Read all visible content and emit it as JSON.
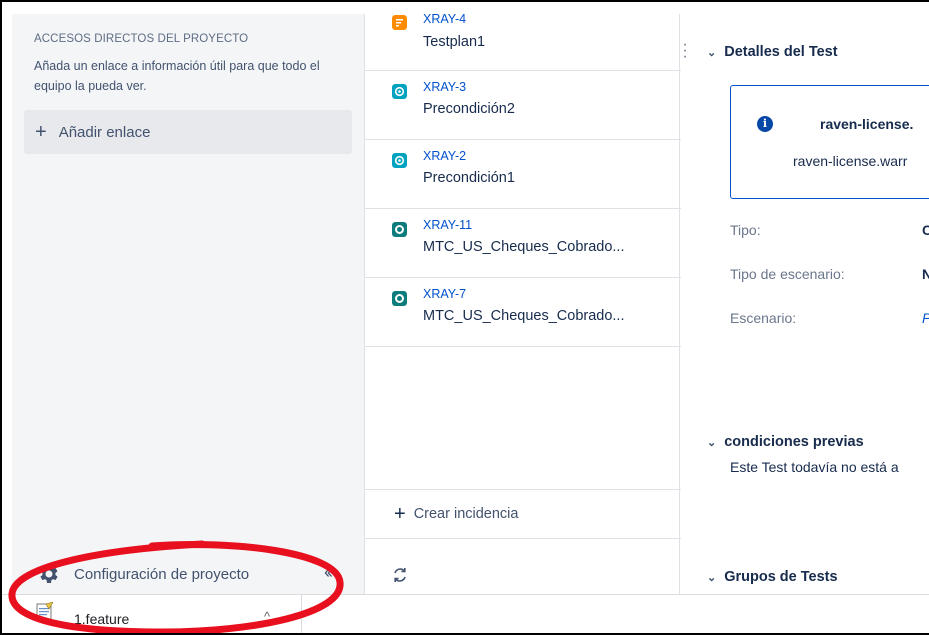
{
  "sidebar": {
    "title": "ACCESOS DIRECTOS DEL PROYECTO",
    "description": "Añada un enlace a información útil para que todo el equipo la pueda ver.",
    "add_link_label": "Añadir enlace",
    "add_link_icon": "+",
    "config_label": "Configuración de proyecto",
    "collapse_icon": "‹‹"
  },
  "issues": [
    {
      "key": "XRAY-4",
      "summary": "Testplan1",
      "type": "test-plan-icon",
      "color": "#ff8b00"
    },
    {
      "key": "XRAY-3",
      "summary": "Precondición2",
      "type": "precondition-icon",
      "color": "#00a3bf"
    },
    {
      "key": "XRAY-2",
      "summary": "Precondición1",
      "type": "precondition-icon",
      "color": "#00a3bf"
    },
    {
      "key": "XRAY-11",
      "summary": "MTC_US_Cheques_Cobrado...",
      "type": "test-icon",
      "color": "#0e7c7b"
    },
    {
      "key": "XRAY-7",
      "summary": "MTC_US_Cheques_Cobrado...",
      "type": "test-icon",
      "color": "#0e7c7b"
    }
  ],
  "issue_list": {
    "create_label": "Crear incidencia",
    "create_icon": "+"
  },
  "detail": {
    "section_details": "Detalles del Test",
    "info_title": "raven-license.",
    "info_text": "raven-license.warr",
    "fields": [
      {
        "label": "Tipo:",
        "value": "C"
      },
      {
        "label": "Tipo de escenario:",
        "value": "N"
      },
      {
        "label": "Escenario:",
        "value": "P"
      }
    ],
    "section_preconditions": "condiciones previas",
    "preconditions_text": "Este Test todavía no está a",
    "section_groups": "Grupos de Tests",
    "chevron": "⌄"
  },
  "download_bar": {
    "file_name": "1.feature",
    "caret": "^"
  },
  "colors": {
    "annotation": "#e8101e",
    "link": "#0052cc",
    "sidebar_bg": "#f4f5f7"
  }
}
